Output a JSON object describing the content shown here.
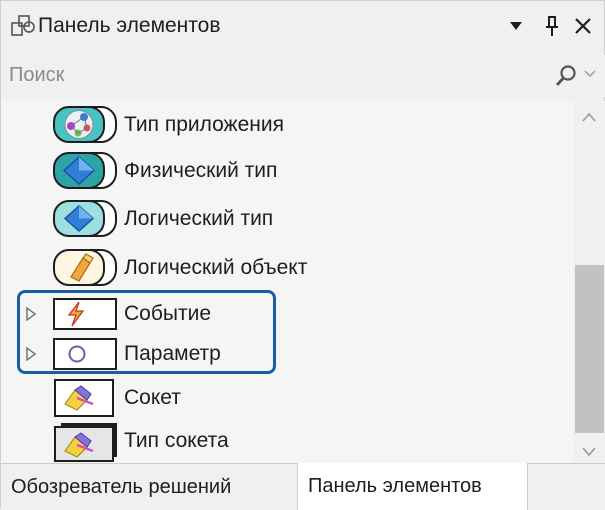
{
  "titlebar": {
    "title": "Панель элементов",
    "icon": "toolbox-icon"
  },
  "search": {
    "placeholder": "Поиск"
  },
  "items": [
    {
      "label": "Тип приложения",
      "icon": "application-type-icon"
    },
    {
      "label": "Физический тип",
      "icon": "physical-type-icon"
    },
    {
      "label": "Логический тип",
      "icon": "logical-type-icon"
    },
    {
      "label": "Логический объект",
      "icon": "logical-object-icon"
    },
    {
      "label": "Событие",
      "icon": "event-icon",
      "expandable": true,
      "selected": true
    },
    {
      "label": "Параметр",
      "icon": "parameter-icon",
      "expandable": true,
      "selected": true
    },
    {
      "label": "Сокет",
      "icon": "socket-icon"
    },
    {
      "label": "Тип сокета",
      "icon": "socket-type-icon"
    }
  ],
  "tabs": [
    {
      "label": "Обозреватель решений",
      "active": false
    },
    {
      "label": "Панель элементов",
      "active": true
    }
  ],
  "colors": {
    "selection_border": "#1a5fa0",
    "teal_frame": "#2c8c8c",
    "diamond_blue": "#2f7fd6"
  }
}
